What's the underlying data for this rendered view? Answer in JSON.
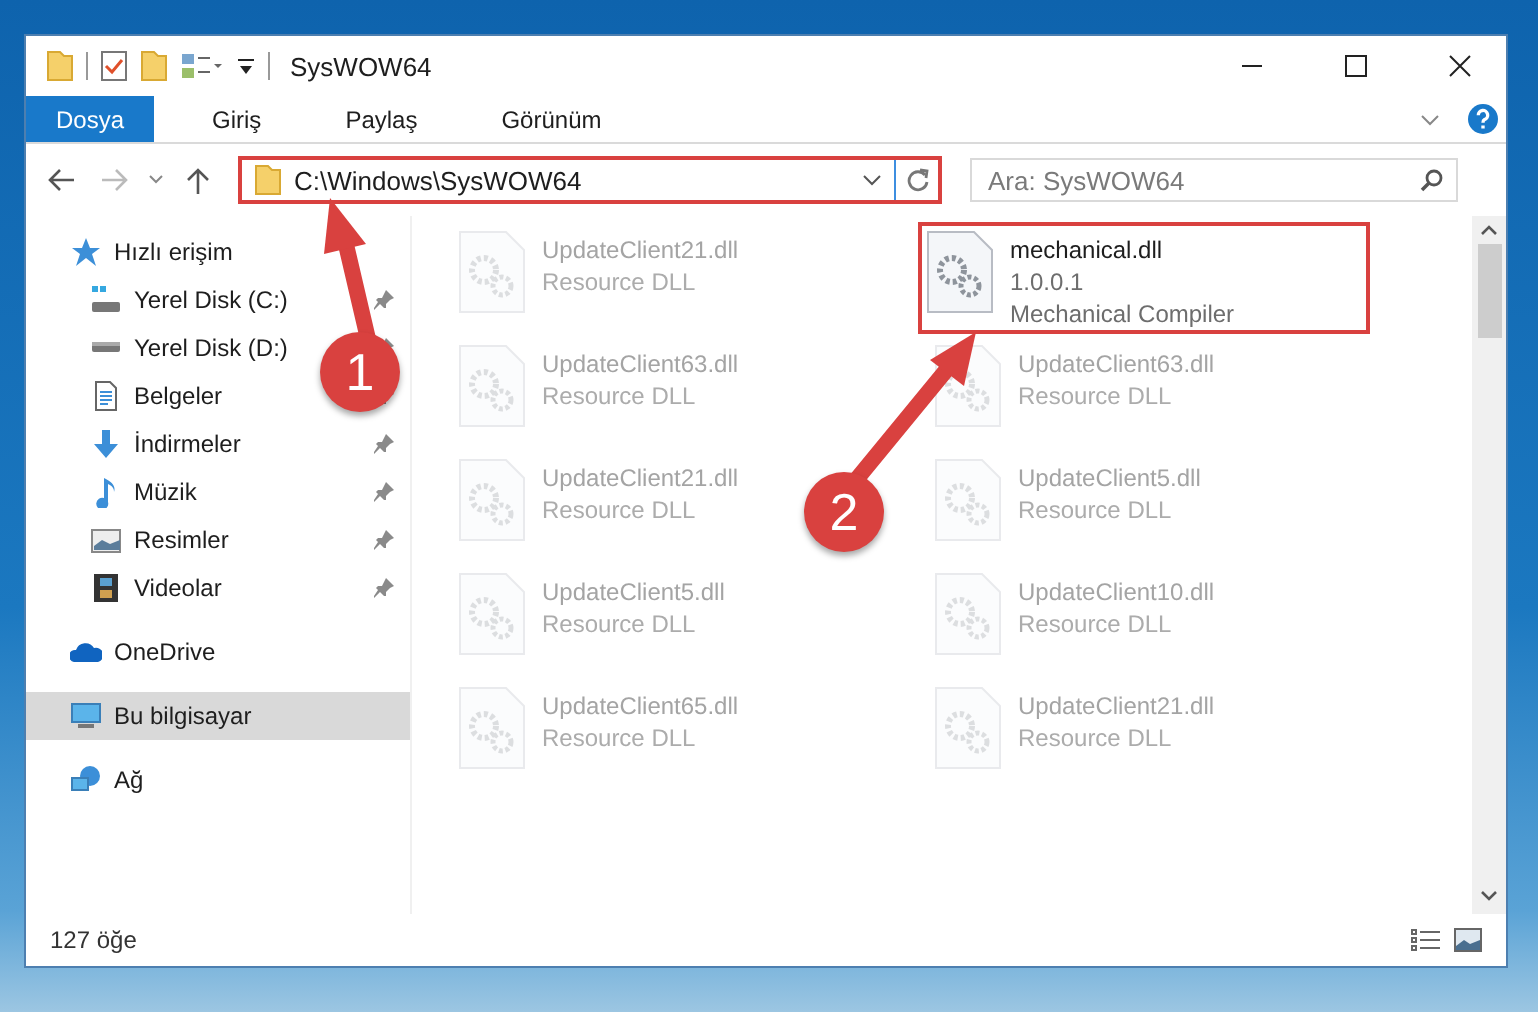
{
  "window": {
    "title": "SysWOW64"
  },
  "ribbon_tabs": [
    {
      "label": "Dosya",
      "selected": true
    },
    {
      "label": "Giriş",
      "selected": false
    },
    {
      "label": "Paylaş",
      "selected": false
    },
    {
      "label": "Görünüm",
      "selected": false
    }
  ],
  "address": {
    "value": "C:\\Windows\\SysWOW64",
    "highlighted": true
  },
  "search": {
    "placeholder": "Ara: SysWOW64"
  },
  "sidebar": {
    "items": [
      {
        "label": "Hızlı erişim",
        "kind": "star",
        "selected": false,
        "children": [
          {
            "label": "Yerel Disk (C:)",
            "kind": "system-drive",
            "pinned": true,
            "selected": false
          },
          {
            "label": "Yerel Disk (D:)",
            "kind": "drive",
            "pinned": true,
            "selected": false
          },
          {
            "label": "Belgeler",
            "kind": "documents",
            "pinned": true,
            "selected": false
          },
          {
            "label": "İndirmeler",
            "kind": "downloads",
            "pinned": true,
            "selected": false
          },
          {
            "label": "Müzik",
            "kind": "music",
            "pinned": true,
            "selected": false
          },
          {
            "label": "Resimler",
            "kind": "pictures",
            "pinned": true,
            "selected": false
          },
          {
            "label": "Videolar",
            "kind": "videos",
            "pinned": true,
            "selected": false
          }
        ]
      },
      {
        "label": "OneDrive",
        "kind": "cloud",
        "selected": false
      },
      {
        "label": "Bu bilgisayar",
        "kind": "computer",
        "selected": true
      },
      {
        "label": "Ağ",
        "kind": "network",
        "selected": false
      }
    ]
  },
  "files": [
    {
      "name": "UpdateClient21.dll",
      "type": "Resource DLL",
      "dimmed": true
    },
    {
      "name": "mechanical.dll",
      "version": "1.0.0.1",
      "type": "Mechanical Compiler",
      "dimmed": false,
      "highlighted": true
    },
    {
      "name": "UpdateClient63.dll",
      "type": "Resource DLL",
      "dimmed": true
    },
    {
      "name": "UpdateClient63.dll",
      "type": "Resource DLL",
      "dimmed": true
    },
    {
      "name": "UpdateClient21.dll",
      "type": "Resource DLL",
      "dimmed": true
    },
    {
      "name": "UpdateClient5.dll",
      "type": "Resource DLL",
      "dimmed": true
    },
    {
      "name": "UpdateClient5.dll",
      "type": "Resource DLL",
      "dimmed": true
    },
    {
      "name": "UpdateClient10.dll",
      "type": "Resource DLL",
      "dimmed": true
    },
    {
      "name": "UpdateClient65.dll",
      "type": "Resource DLL",
      "dimmed": true
    },
    {
      "name": "UpdateClient21.dll",
      "type": "Resource DLL",
      "dimmed": true
    }
  ],
  "status_bar": {
    "item_count": "127 öğe"
  },
  "annotations": [
    {
      "number": "1"
    },
    {
      "number": "2"
    }
  ]
}
